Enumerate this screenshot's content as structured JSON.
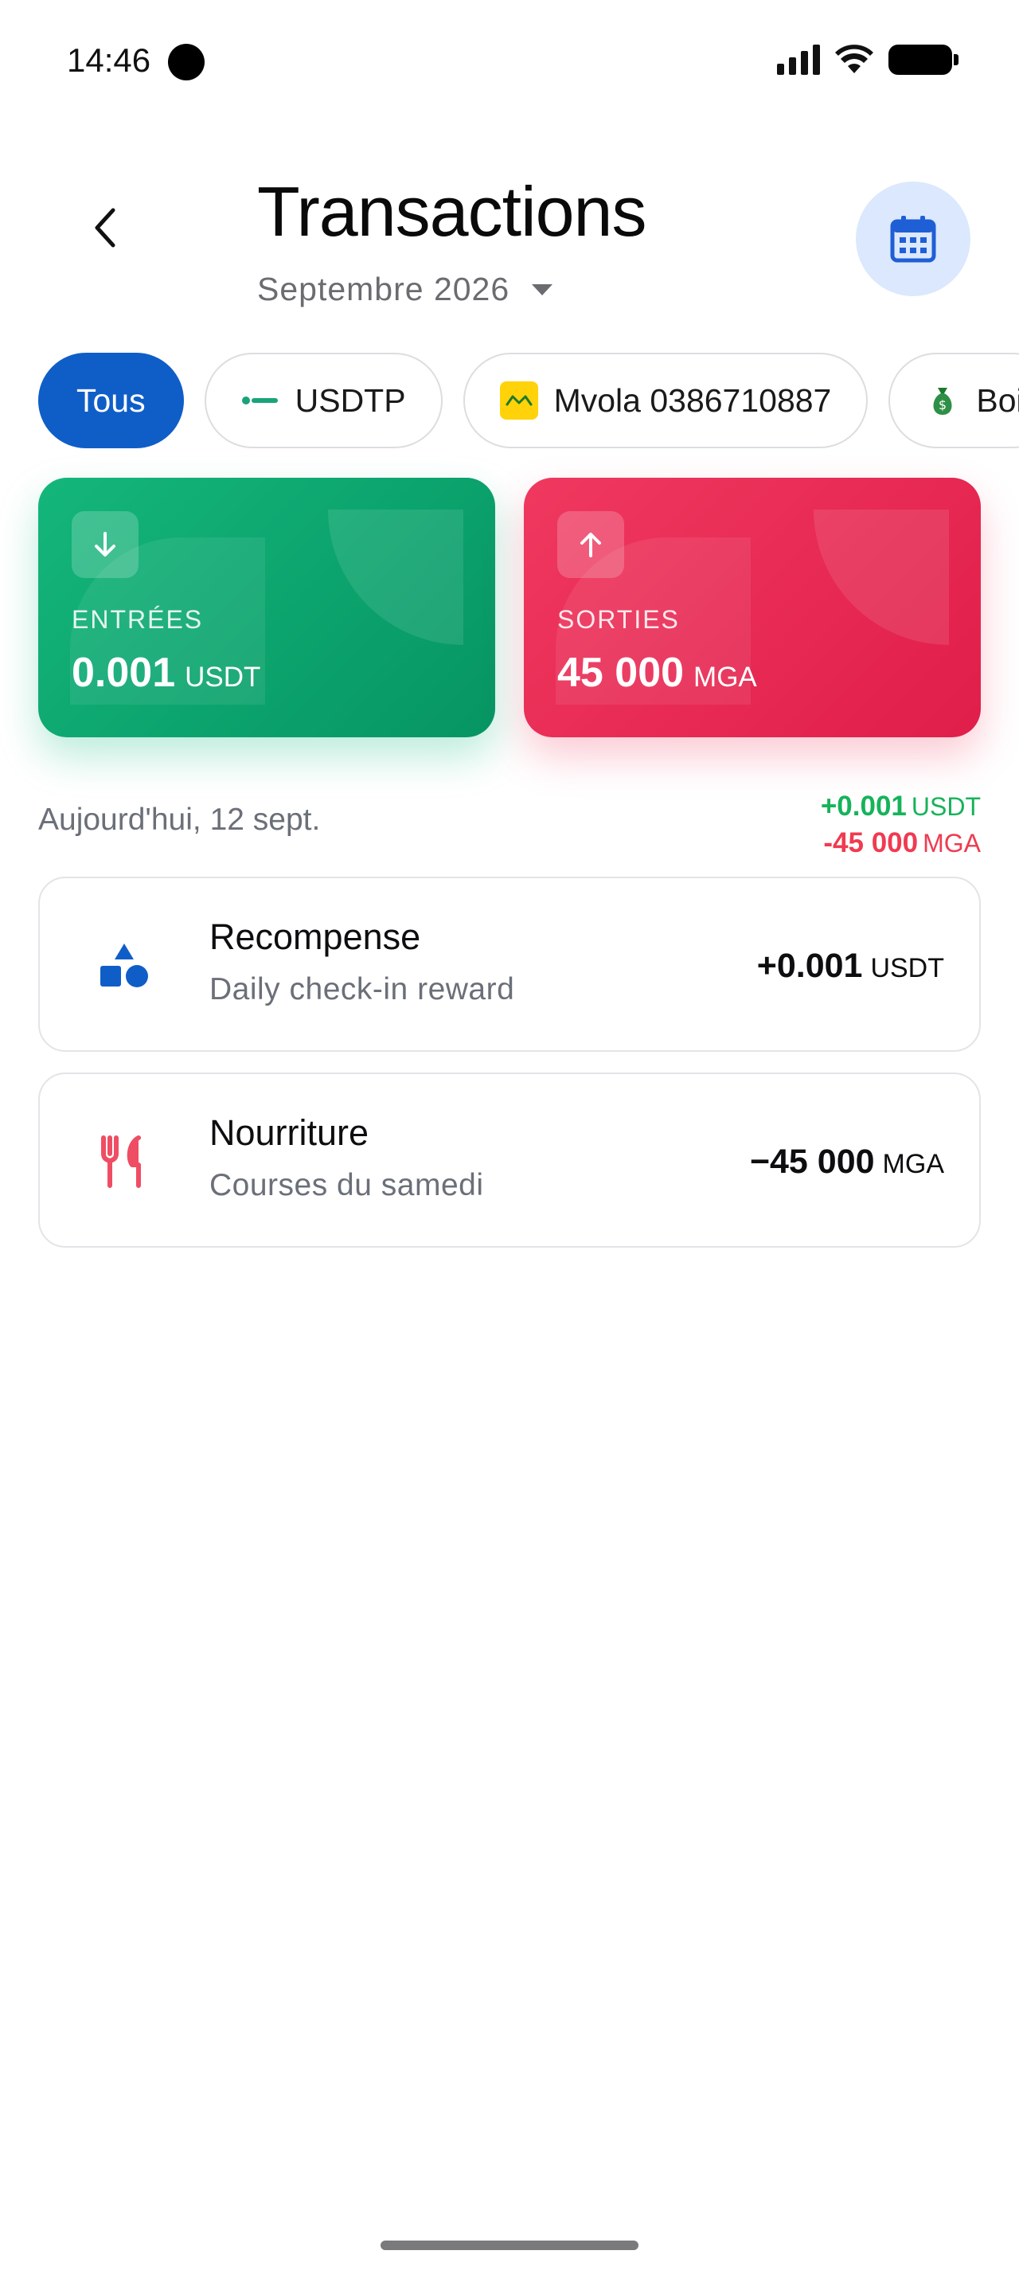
{
  "status_bar": {
    "time": "14:46"
  },
  "header": {
    "title": "Transactions",
    "month": "Septembre 2026"
  },
  "filters": [
    {
      "label": "Tous",
      "active": true,
      "icon": "none"
    },
    {
      "label": "USDTP",
      "active": false,
      "icon": "tether-logo"
    },
    {
      "label": "Mvola 0386710887",
      "active": false,
      "icon": "mvola-logo"
    },
    {
      "label": "Boi",
      "active": false,
      "icon": "money-bag-icon"
    }
  ],
  "summary": {
    "income": {
      "label": "ENTRÉES",
      "value": "0.001",
      "unit": "USDT",
      "color": "#10b37a"
    },
    "expense": {
      "label": "SORTIES",
      "value": "45 000",
      "unit": "MGA",
      "color": "#e8264f"
    }
  },
  "day_group": {
    "label": "Aujourd'hui, 12 sept.",
    "totals": [
      {
        "value": "+0.001",
        "unit": "USDT",
        "color": "#16b35a"
      },
      {
        "value": "-45 000",
        "unit": "MGA",
        "color": "#ef3b50"
      }
    ]
  },
  "transactions": [
    {
      "title": "Recompense",
      "subtitle": "Daily check-in reward",
      "amount": "+0.001",
      "unit": "USDT",
      "icon": "shapes-icon",
      "icon_color": "#0f5ec8"
    },
    {
      "title": "Nourriture",
      "subtitle": "Courses du samedi",
      "amount": "−45 000",
      "unit": "MGA",
      "icon": "fork-knife-icon",
      "icon_color": "#ef4d64"
    }
  ],
  "colors": {
    "primary": "#0f5ec8",
    "calendar_bg": "#dbe8fd",
    "text_muted": "#6b6f78"
  }
}
